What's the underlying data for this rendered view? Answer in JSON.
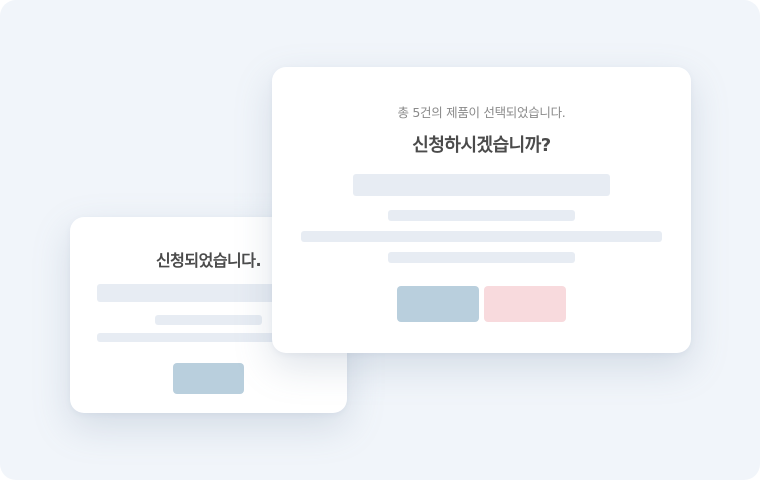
{
  "back_dialog": {
    "message": "신청되었습니다."
  },
  "front_dialog": {
    "summary": "총 5건의 제품이 선택되었습니다.",
    "question": "신청하시겠습니까?"
  },
  "colors": {
    "background": "#f1f5fa",
    "card": "#ffffff",
    "placeholder_bar": "#e7ecf3",
    "confirm_button": "#b9cfdd",
    "cancel_button": "#f8dadd",
    "title_text": "#4b4b4b",
    "sub_text": "#8a8a8a"
  }
}
